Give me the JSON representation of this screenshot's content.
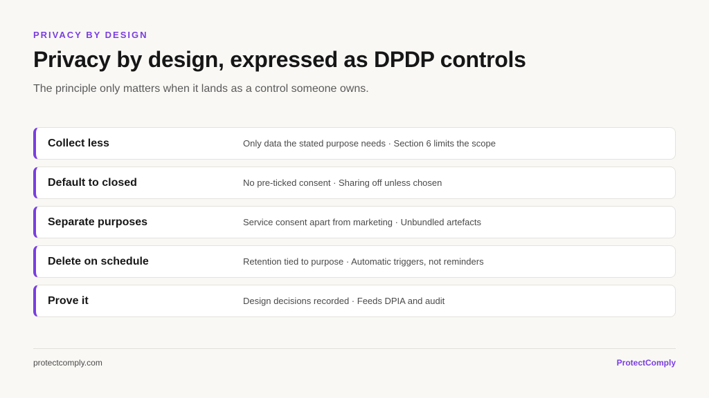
{
  "header": {
    "eyebrow": "PRIVACY BY DESIGN",
    "title": "Privacy by design, expressed as DPDP controls",
    "subtitle": "The principle only matters when it lands as a control someone owns."
  },
  "rows": [
    {
      "label": "Collect less",
      "description": "Only data the stated purpose needs · Section 6 limits the scope"
    },
    {
      "label": "Default to closed",
      "description": "No pre-ticked consent · Sharing off unless chosen"
    },
    {
      "label": "Separate purposes",
      "description": "Service consent apart from marketing · Unbundled artefacts"
    },
    {
      "label": "Delete on schedule",
      "description": "Retention tied to purpose · Automatic triggers, not reminders"
    },
    {
      "label": "Prove it",
      "description": "Design decisions recorded · Feeds DPIA and audit"
    }
  ],
  "footer": {
    "website": "protectcomply.com",
    "brand": "ProtectComply"
  },
  "colors": {
    "accent": "#7a3ee0",
    "background": "#f9f8f5"
  }
}
